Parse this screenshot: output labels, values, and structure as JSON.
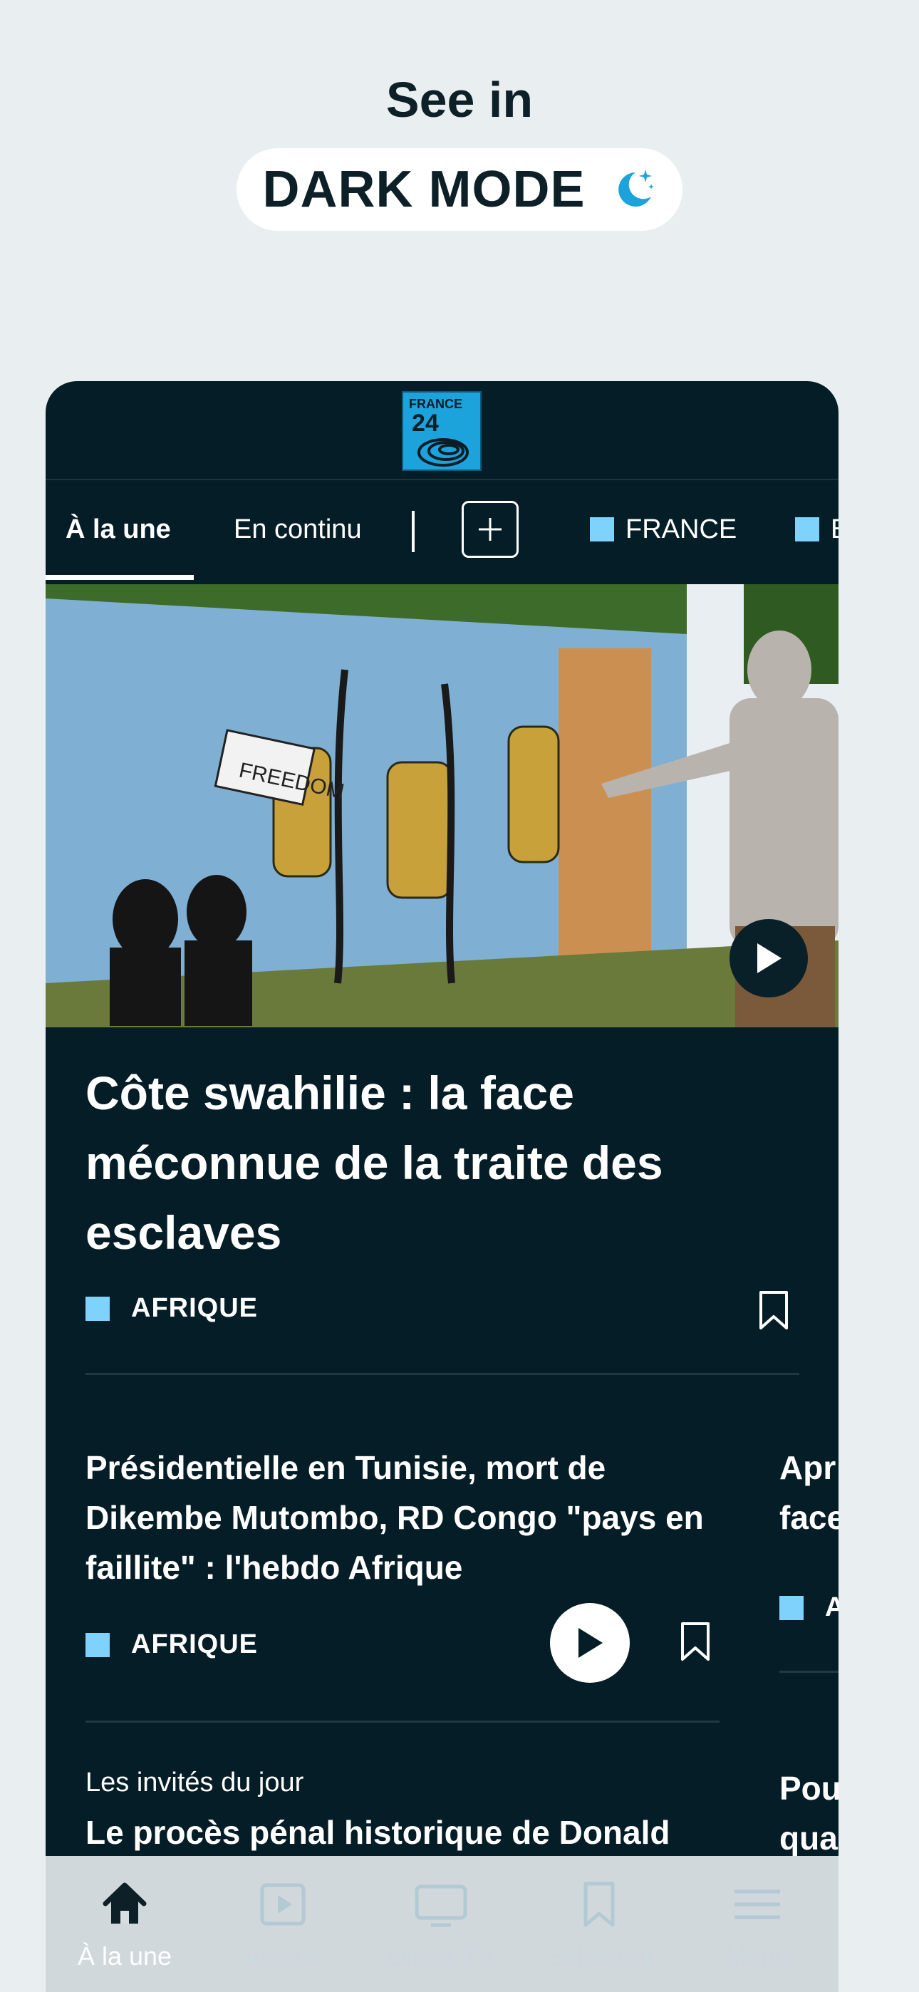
{
  "promo": {
    "title": "See in",
    "pill_label": "DARK MODE",
    "pill_icon": "moon-stars-icon"
  },
  "app": {
    "brand": {
      "line1": "FRANCE",
      "line2": "24"
    },
    "tabs": [
      {
        "label": "À la une",
        "active": true
      },
      {
        "label": "En continu",
        "active": false
      }
    ],
    "add_icon": "plus-icon",
    "category_tabs": [
      {
        "label": "FRANCE",
        "color": "#7fd2fb"
      },
      {
        "label": "E",
        "color": "#7fd2fb"
      }
    ],
    "hero": {
      "headline": "Côte swahilie : la face méconnue de la traite des esclaves",
      "category": "AFRIQUE",
      "banner_text": "FREEDOM"
    },
    "cards": [
      {
        "title": "Présidentielle en Tunisie, mort de Dikembe Mutombo, RD Congo \"pays en faillite\" : l'hebdo Afrique",
        "category": "AFRIQUE"
      },
      {
        "title": "Apr\nface",
        "category": "A"
      },
      {
        "kicker": "Les invités du jour",
        "title": "Le procès pénal historique de Donald"
      },
      {
        "title": "Pou\nqua"
      }
    ],
    "accent_color": "#7fd2fb",
    "background_color": "#051d26",
    "bottom_nav": [
      {
        "label": "À la une",
        "icon": "home-icon",
        "active": true
      },
      {
        "label": "Vidéos",
        "icon": "video-icon",
        "active": false
      },
      {
        "label": "Direct TV",
        "icon": "tv-icon",
        "active": false
      },
      {
        "label": "Sélection",
        "icon": "bookmark-icon",
        "active": false
      },
      {
        "label": "Menu",
        "icon": "menu-icon",
        "active": false
      }
    ]
  }
}
